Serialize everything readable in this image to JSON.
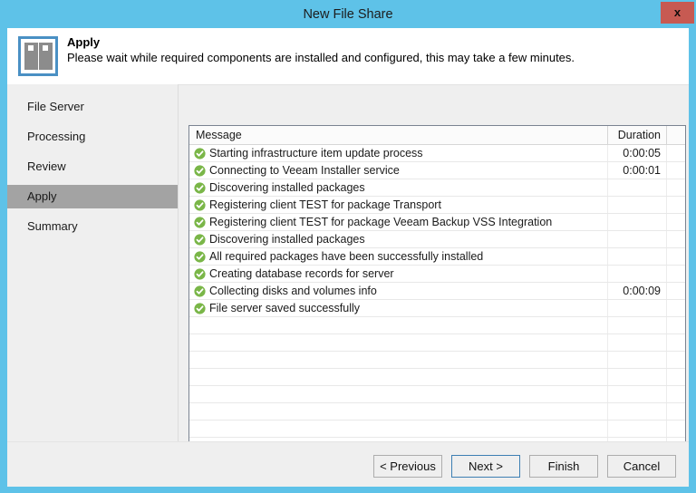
{
  "window": {
    "title": "New File Share",
    "close_label": "x",
    "titlebar_color": "#5ec2e8",
    "close_color": "#c75a52"
  },
  "header": {
    "icon": "file-share-icon",
    "title": "Apply",
    "subtitle": "Please wait while required components are installed and configured, this may take a few minutes."
  },
  "sidebar": {
    "items": [
      {
        "label": "File Server",
        "active": false
      },
      {
        "label": "Processing",
        "active": false
      },
      {
        "label": "Review",
        "active": false
      },
      {
        "label": "Apply",
        "active": true
      },
      {
        "label": "Summary",
        "active": false
      }
    ],
    "active_color": "#a3a3a3"
  },
  "list": {
    "columns": {
      "message": "Message",
      "duration": "Duration"
    },
    "status_icon": "green-check-icon",
    "status_color": "#7ab648",
    "rows": [
      {
        "message": "Starting infrastructure item update process",
        "duration": "0:00:05"
      },
      {
        "message": "Connecting to Veeam Installer service",
        "duration": "0:00:01"
      },
      {
        "message": "Discovering installed packages",
        "duration": ""
      },
      {
        "message": "Registering client TEST for package Transport",
        "duration": ""
      },
      {
        "message": "Registering client TEST for package Veeam Backup VSS Integration",
        "duration": ""
      },
      {
        "message": "Discovering installed packages",
        "duration": ""
      },
      {
        "message": "All required packages have been successfully installed",
        "duration": ""
      },
      {
        "message": "Creating database records for server",
        "duration": ""
      },
      {
        "message": "Collecting disks and volumes info",
        "duration": "0:00:09"
      },
      {
        "message": "File server saved successfully",
        "duration": ""
      }
    ],
    "empty_row_count": 8
  },
  "buttons": {
    "previous": "< Previous",
    "next": "Next >",
    "finish": "Finish",
    "cancel": "Cancel"
  }
}
